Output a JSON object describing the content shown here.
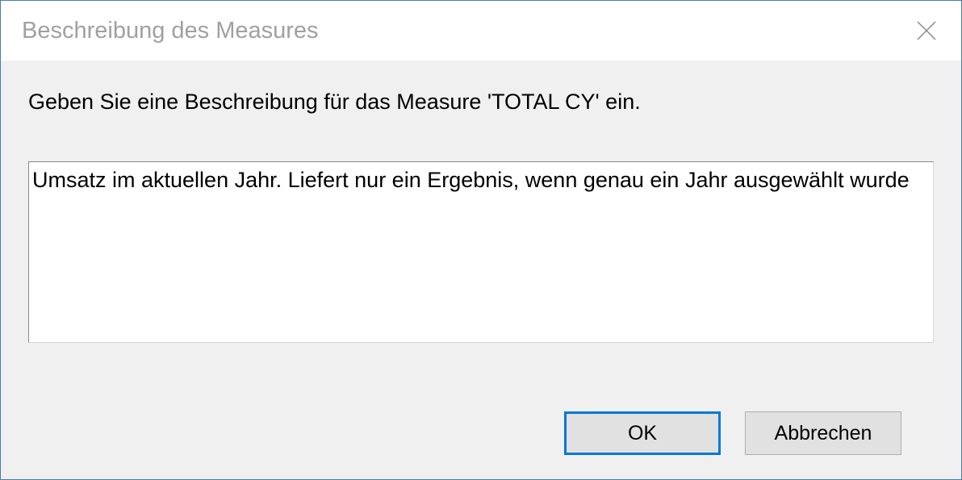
{
  "titlebar": {
    "title": "Beschreibung des Measures"
  },
  "content": {
    "prompt": "Geben Sie eine Beschreibung für das Measure 'TOTAL CY' ein.",
    "description_value": "Umsatz im aktuellen Jahr. Liefert nur ein Ergebnis, wenn genau ein Jahr ausgewählt wurde"
  },
  "buttons": {
    "ok_label": "OK",
    "cancel_label": "Abbrechen"
  }
}
